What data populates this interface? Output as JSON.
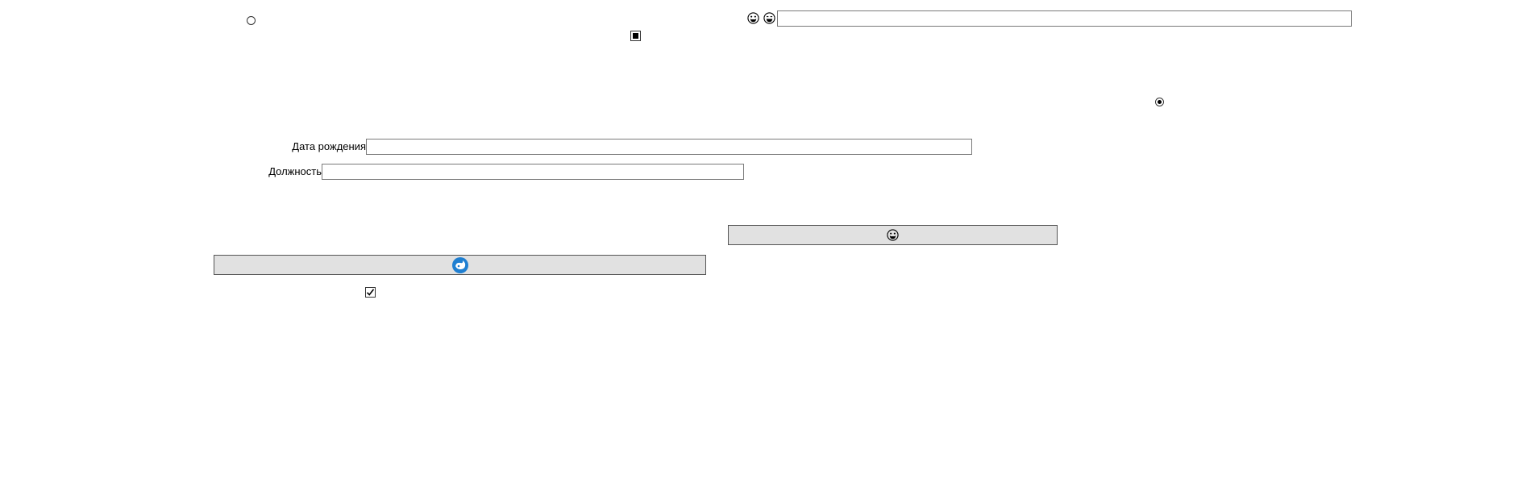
{
  "form": {
    "birth_date": {
      "label": "Дата рождения",
      "value": ""
    },
    "position": {
      "label": "Должность",
      "value": ""
    },
    "top_text": {
      "value": ""
    },
    "radio_top_left": {
      "checked": false
    },
    "radio_right": {
      "checked": true
    },
    "checkbox_top": {
      "state": "indeterminate"
    },
    "checkbox_bottom": {
      "state": "checked"
    }
  },
  "icons": {
    "top_left": "grinning-face-icon",
    "top_right": "smiling-face-icon",
    "button_right": "grinning-face-icon",
    "button_left": "blue-swirl-icon"
  },
  "colors": {
    "button_face": "#e1e1e1",
    "blue_icon": "#1f7fd1",
    "border": "#7a7a7a"
  }
}
